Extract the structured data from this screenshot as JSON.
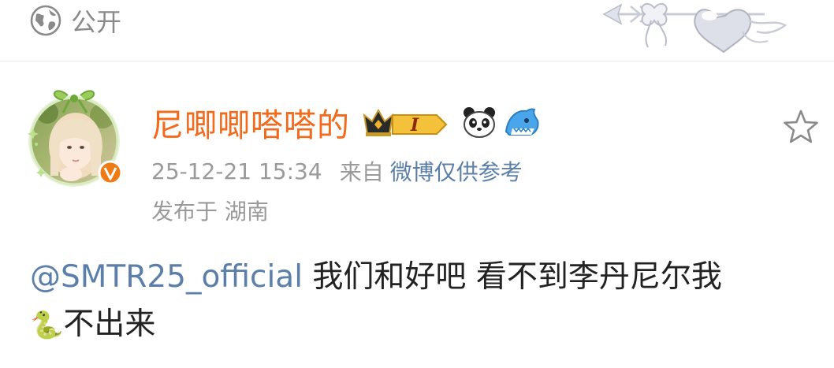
{
  "header": {
    "visibility_label": "公开",
    "visibility_icon": "globe-icon",
    "decoration": "arrow-heart-ribbon-decoration"
  },
  "post": {
    "author": {
      "name": "尼唧唧嗒嗒的",
      "avatar": "avatar-photo",
      "verified_badge": "V",
      "badges": [
        "crown-level-badge",
        "panda-emoji-badge",
        "shark-badge"
      ],
      "level_label": "I"
    },
    "time": "25-12-21 15:34",
    "source_prefix": "来自",
    "source": "微博仅供参考",
    "location": "发布于 湖南",
    "content": {
      "mention": "@SMTR25_official",
      "text_line1": " 我们和好吧 看不到李丹尼尔我",
      "emoji": "🐍",
      "text_line2": "不出来"
    },
    "favorite_icon": "star-icon"
  },
  "colors": {
    "username": "#f36a1c",
    "link": "#5b7fa8",
    "meta": "#9a9a9a",
    "verified": "#f07a14"
  }
}
